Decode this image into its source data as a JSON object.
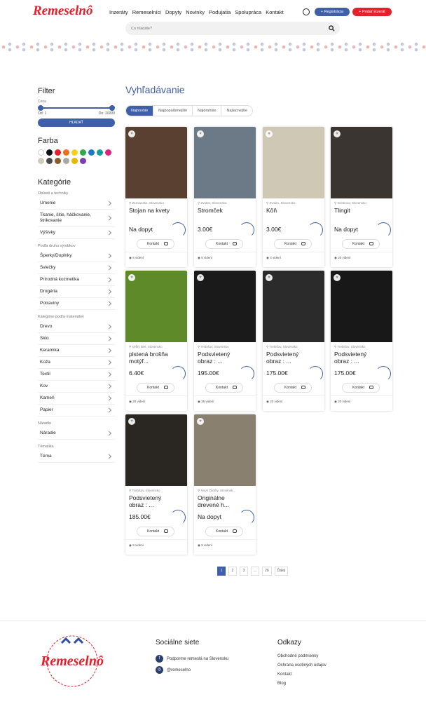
{
  "header": {
    "logo": "Remeselnô",
    "nav": [
      "Inzeráty",
      "Remeselníci",
      "Dopyty",
      "Novinky",
      "Podujatia",
      "Spolupráca",
      "Kontakt"
    ],
    "register": "Registrácia",
    "add_ad": "Pridať inzerát",
    "search_placeholder": "Čo hľadáte?"
  },
  "sidebar": {
    "filter_title": "Filter",
    "price_label": "Cena",
    "price_from": "Od: 1",
    "price_to": "Do: 20000",
    "search_btn": "HĽADAŤ",
    "color_title": "Farba",
    "colors": [
      "#ffffff",
      "#111111",
      "#e4202a",
      "#e8701a",
      "#f2d21b",
      "#2eaa4a",
      "#1d78c6",
      "#11a0a0",
      "#e0237a",
      "#d0cbb8",
      "#4a4a4a",
      "#8b5a2b",
      "#a9a9a9",
      "#e6b800",
      "#7a3fb0"
    ],
    "categories_title": "Kategórie",
    "groups": [
      {
        "label": "Oblasti a techniky",
        "items": [
          "Umenie",
          "Tkanie, šitie, háčkovanie, štrikovanie",
          "Výšivky"
        ]
      },
      {
        "label": "Podľa druhu výrobkov",
        "items": [
          "Šperky/Doplnky",
          "Sviečky",
          "Prírodná kozmetika",
          "Drogéria",
          "Potraviny"
        ]
      },
      {
        "label": "Kategórie podľa materiálov",
        "items": [
          "Drevo",
          "Sklo",
          "Keramika",
          "Koža",
          "Textil",
          "Kov",
          "Kameň",
          "Papier"
        ]
      },
      {
        "label": "Náradie",
        "items": [
          "Náradie"
        ]
      },
      {
        "label": "Tématika",
        "items": [
          "Téma"
        ]
      }
    ]
  },
  "main": {
    "title": "Vyhľadávanie",
    "sorts": [
      "Najnovšie",
      "Najpopulárnejšie",
      "Najdrahšie",
      "Najlacnejšie"
    ],
    "contact_label": "Kontakt",
    "products": [
      {
        "location": "Zemianske, Slovensko",
        "name": "Stojan na kvety",
        "price": "Na dopyt",
        "views": "6 videní",
        "img": "#5a4030"
      },
      {
        "location": "Zvolen, Slovensko",
        "name": "Stromček",
        "price": "3.00€",
        "views": "5 videní",
        "img": "#6b7a86"
      },
      {
        "location": "Zvolen, Slovensko",
        "name": "Kôň",
        "price": "3.00€",
        "views": "4 videní",
        "img": "#cfc8b4"
      },
      {
        "location": "Grinkovo, Slovensko",
        "name": "Tlingit",
        "price": "Na dopyt",
        "views": "20 videní",
        "img": "#3a3530"
      },
      {
        "location": "Veľký Biel, Slovensko",
        "name": "plstená brošňa motýľ...",
        "price": "6.40€",
        "views": "20 videní",
        "img": "#5f8a2a"
      },
      {
        "location": "Trebišov, Slovensko",
        "name": "Podsvietený obraz : ...",
        "price": "195.00€",
        "views": "35 videní",
        "img": "#1a1a1a"
      },
      {
        "location": "Trebišov, Slovensko",
        "name": "Podsvietený obraz : ...",
        "price": "175.00€",
        "views": "20 videní",
        "img": "#2b2b2b"
      },
      {
        "location": "Trebišov, Slovensko",
        "name": "Podsvietený obraz : ...",
        "price": "175.00€",
        "views": "20 videní",
        "img": "#181818"
      },
      {
        "location": "Trebišov, Slovensko",
        "name": "Podsvietený obraz : ...",
        "price": "185.00€",
        "views": "9 videní",
        "img": "#2a2622"
      },
      {
        "location": "Nové Zámky, Slovensk...",
        "name": "Originálne drevené h...",
        "price": "Na dopyt",
        "views": "9 videní",
        "img": "#8a8070"
      }
    ]
  },
  "pagination": [
    "1",
    "2",
    "3",
    "...",
    "26",
    "Ďalej"
  ],
  "footer": {
    "social_title": "Sociálne siete",
    "facebook": "Podporme remeslá na Slovensku",
    "instagram": "@remeselno",
    "links_title": "Odkazy",
    "links": [
      "Obchodné podmienky",
      "Ochrana osobných údajov",
      "Kontakt",
      "Blog"
    ]
  },
  "icons": {
    "heart": "heart-icon",
    "chat": "chat-icon",
    "eye": "eye-icon",
    "pin": "pin-icon",
    "search": "search-icon",
    "user": "user-icon"
  },
  "accent": "#3f5fa8",
  "brand_red": "#e4202a"
}
